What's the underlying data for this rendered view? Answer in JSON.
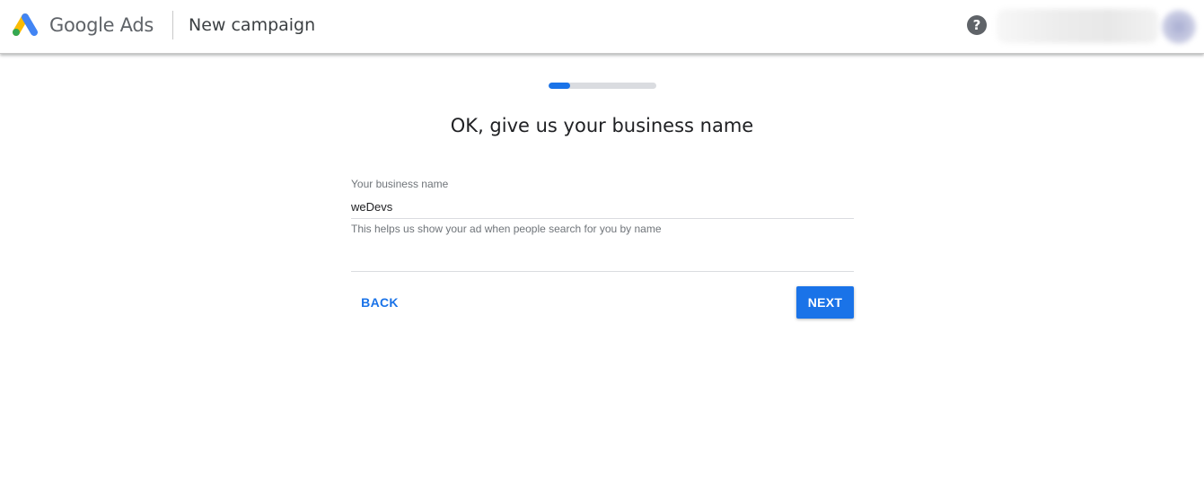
{
  "header": {
    "brand": "Google Ads",
    "page_title": "New campaign",
    "help_icon": "help-circle-icon",
    "help_glyph": "?"
  },
  "progress": {
    "value": 0.2
  },
  "main": {
    "heading": "OK, give us your business name",
    "business_name_field": {
      "label": "Your business name",
      "value": "weDevs",
      "helper": "This helps us show your ad when people search for you by name"
    },
    "back_label": "BACK",
    "next_label": "NEXT"
  },
  "colors": {
    "accent": "#1a73e8",
    "logo_blue": "#4285f4",
    "logo_yellow": "#fbbc04",
    "logo_green": "#34a853",
    "text_secondary": "#70757a"
  }
}
